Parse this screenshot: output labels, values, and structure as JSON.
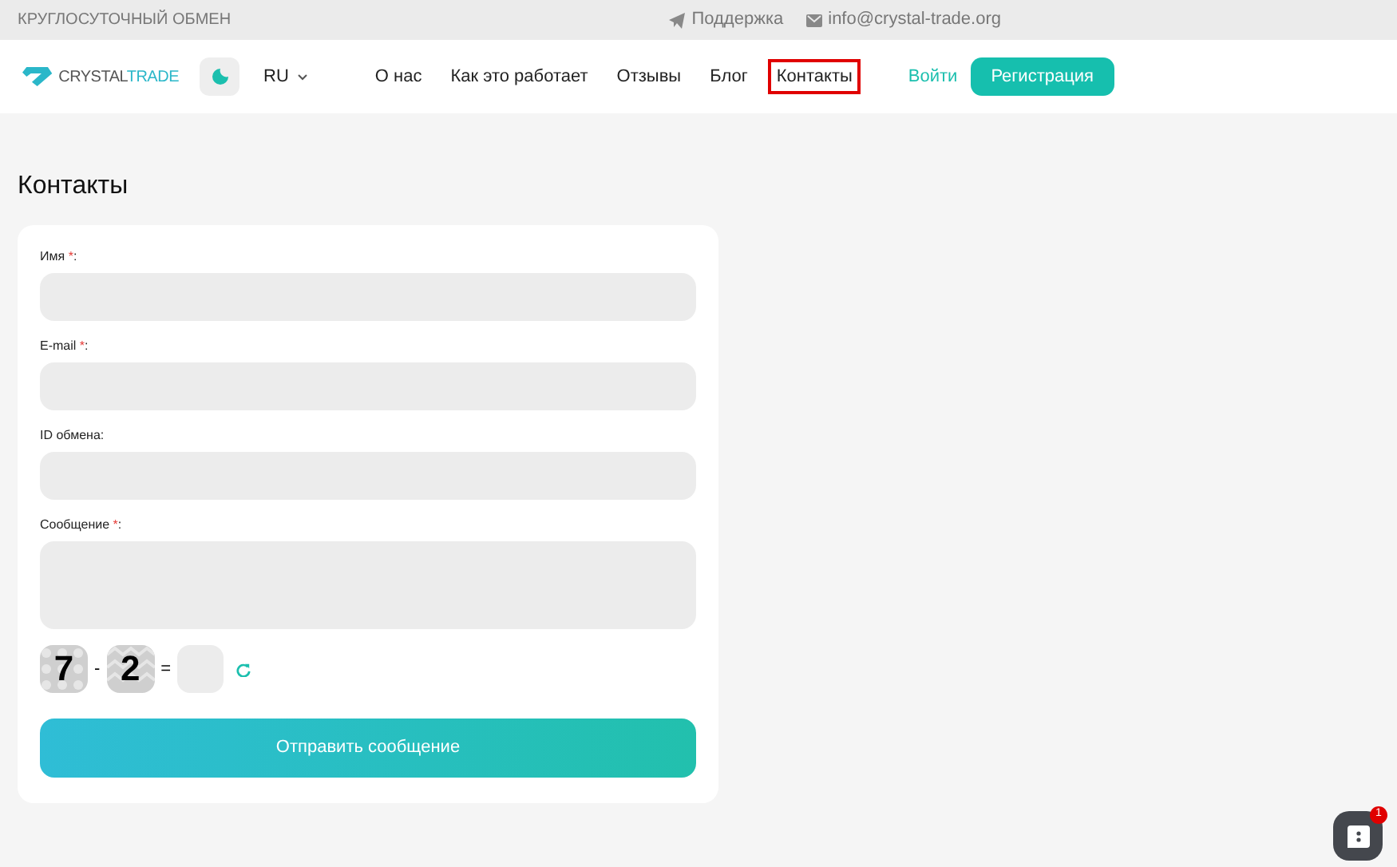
{
  "top_bar": {
    "tagline": "КРУГЛОСУТОЧНЫЙ ОБМЕН",
    "support": "Поддержка",
    "email": "info@crystal-trade.org"
  },
  "header": {
    "logo": {
      "part_1": "CRYSTAL",
      "part_2": "TRADE"
    },
    "language": "RU",
    "nav": [
      {
        "label": "О нас",
        "selected": false
      },
      {
        "label": "Как это работает",
        "selected": false
      },
      {
        "label": "Отзывы",
        "selected": false
      },
      {
        "label": "Блог",
        "selected": false
      },
      {
        "label": "Контакты",
        "selected": true
      }
    ],
    "login": "Войти",
    "register": "Регистрация"
  },
  "page_title": "Контакты",
  "form": {
    "fields": [
      {
        "label": "Имя",
        "required": true,
        "kind": "input"
      },
      {
        "label": "E-mail",
        "required": true,
        "kind": "input"
      },
      {
        "label": "ID обмена",
        "required": false,
        "kind": "input"
      },
      {
        "label": "Сообщение",
        "required": true,
        "kind": "textarea"
      }
    ],
    "required_mark": "*",
    "label_suffix": ":",
    "captcha": {
      "first": "7",
      "operator": "-",
      "second": "2",
      "equals": "="
    },
    "submit": "Отправить сообщение"
  },
  "chat": {
    "badge": "1"
  }
}
